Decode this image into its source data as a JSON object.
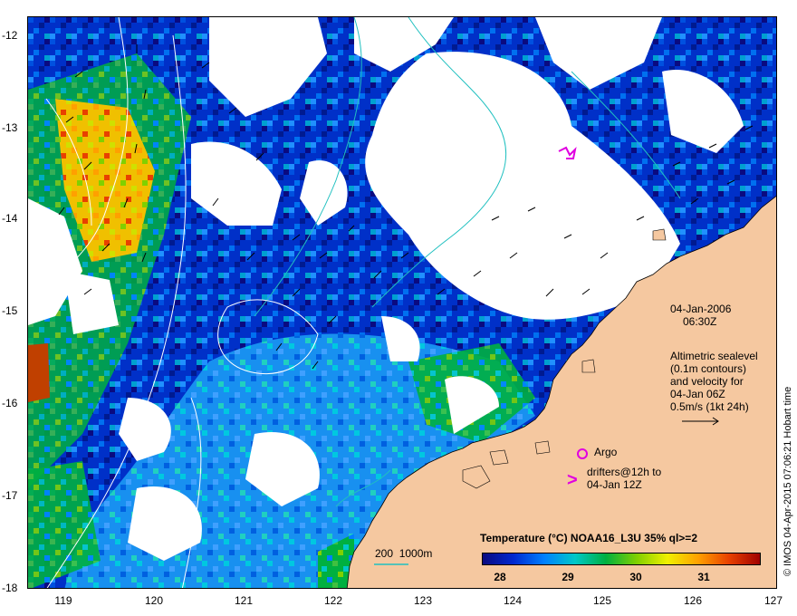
{
  "map": {
    "y_ticks": [
      "-12",
      "-13",
      "-14",
      "-15",
      "-16",
      "-17",
      "-18"
    ],
    "x_ticks": [
      "119",
      "120",
      "121",
      "122",
      "123",
      "124",
      "125",
      "126",
      "127"
    ],
    "lat_range": [
      -18,
      -11.75
    ],
    "lon_range": [
      118.6,
      127
    ]
  },
  "annotations": {
    "date": "04-Jan-2006",
    "time": "06:30Z",
    "alt_line1": "Altimetric sealevel",
    "alt_line2": "(0.1m contours)",
    "alt_line3": "and velocity for",
    "alt_line4": "04-Jan 06Z",
    "alt_line5": "0.5m/s (1kt 24h)",
    "argo_label": "Argo",
    "drifter_marker": ">",
    "drifter_line1": "drifters@12h to",
    "drifter_line2": "04-Jan 12Z",
    "depth_legend": "200  1000m"
  },
  "colorbar": {
    "title": "Temperature (°C) NOAA16_L3U 35% ql>=2",
    "ticks": [
      "28",
      "29",
      "30",
      "31"
    ],
    "range": [
      27.7,
      31.8
    ]
  },
  "credit": "© IMOS 04-Apr-2015 07:06:21 Hobart time",
  "colors": {
    "land": "#f5c8a0",
    "sst_low": "#0a0a80",
    "sst_mid": "#00b040",
    "sst_high": "#a00000",
    "argo": "#e000e0",
    "drifter": "#e000e0",
    "depth_contour": "#20c0c0",
    "sealevel_contour": "#ffffff"
  }
}
